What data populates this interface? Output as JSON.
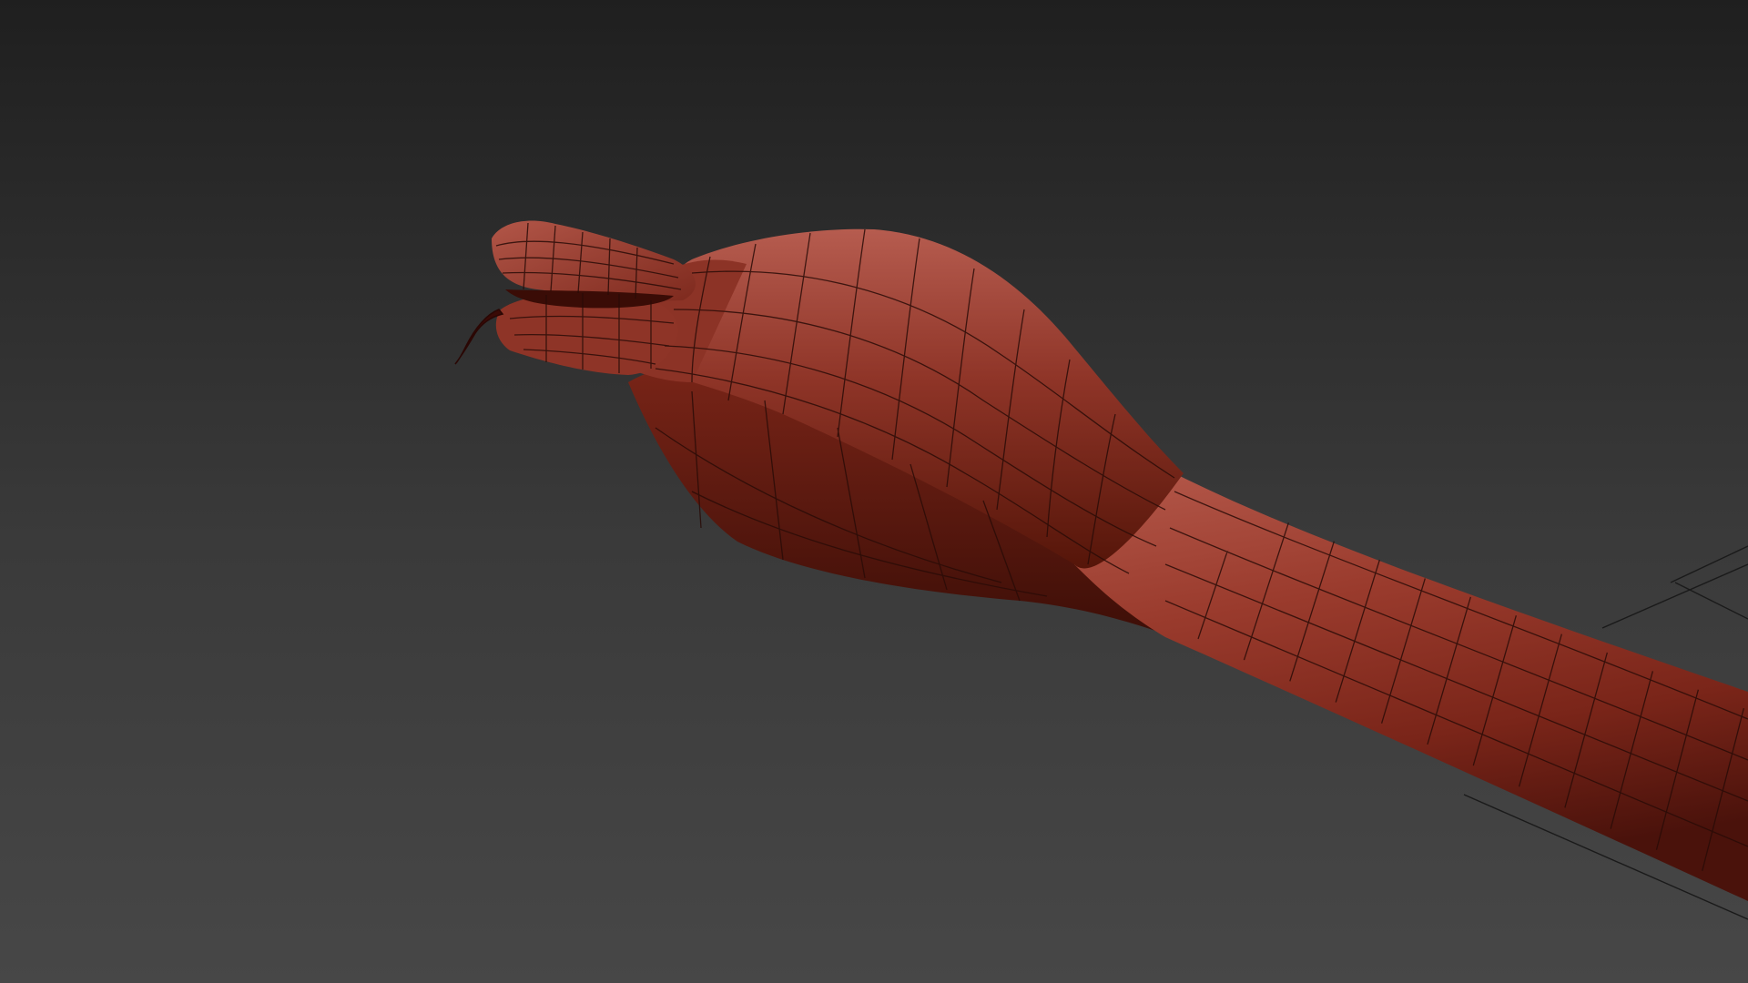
{
  "viewport": {
    "background_top": "#1f1f1f",
    "background_bottom": "#474747"
  },
  "model": {
    "name_icon": "snake-mesh",
    "surface_color": "#9a3a2c",
    "wire_color": "#2a0c08",
    "tongue_color": "#3a0a06"
  },
  "grid": {
    "visible": true,
    "line_color": "#1a1a1a"
  }
}
